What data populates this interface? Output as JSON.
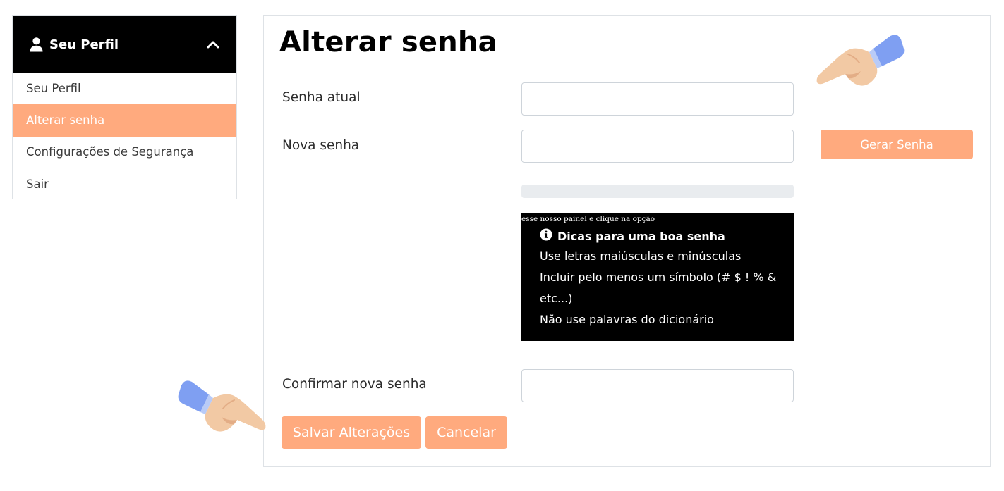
{
  "sidebar": {
    "header": {
      "title": "Seu Perfil",
      "icon": "user-icon",
      "toggle_icon": "chevron-up-icon"
    },
    "items": [
      {
        "label": "Seu Perfil",
        "active": false
      },
      {
        "label": "Alterar senha",
        "active": true
      },
      {
        "label": "Configurações de Segurança",
        "active": false
      },
      {
        "label": "Sair",
        "active": false
      }
    ]
  },
  "main": {
    "title": "Alterar senha",
    "fields": {
      "current_password": {
        "label": "Senha atual",
        "value": "",
        "placeholder": ""
      },
      "new_password": {
        "label": "Nova senha",
        "value": "",
        "placeholder": ""
      },
      "confirm_password": {
        "label": "Confirmar nova senha",
        "value": "",
        "placeholder": ""
      }
    },
    "generate_button": "Gerar Senha",
    "strength_meter": {
      "fill_percent": 0
    },
    "tips": {
      "caption": "esse nosso painel e clique na opção",
      "icon": "info-circle-icon",
      "heading": "Dicas para uma boa senha",
      "items": [
        "Use letras maiúsculas e minúsculas",
        "Incluir pelo menos um símbolo (# $ ! % & etc...)",
        "Não use palavras do dicionário"
      ]
    },
    "save_button": "Salvar Alterações",
    "cancel_button": "Cancelar"
  },
  "annotations": {
    "top_hand_icon": "pointing-hand-left-icon",
    "bottom_hand_icon": "pointing-hand-right-icon"
  },
  "colors": {
    "accent": "#ffaa7e",
    "sidebar_header_bg": "#000000",
    "tips_bg": "#000000",
    "meter_track": "#e9ecef"
  }
}
